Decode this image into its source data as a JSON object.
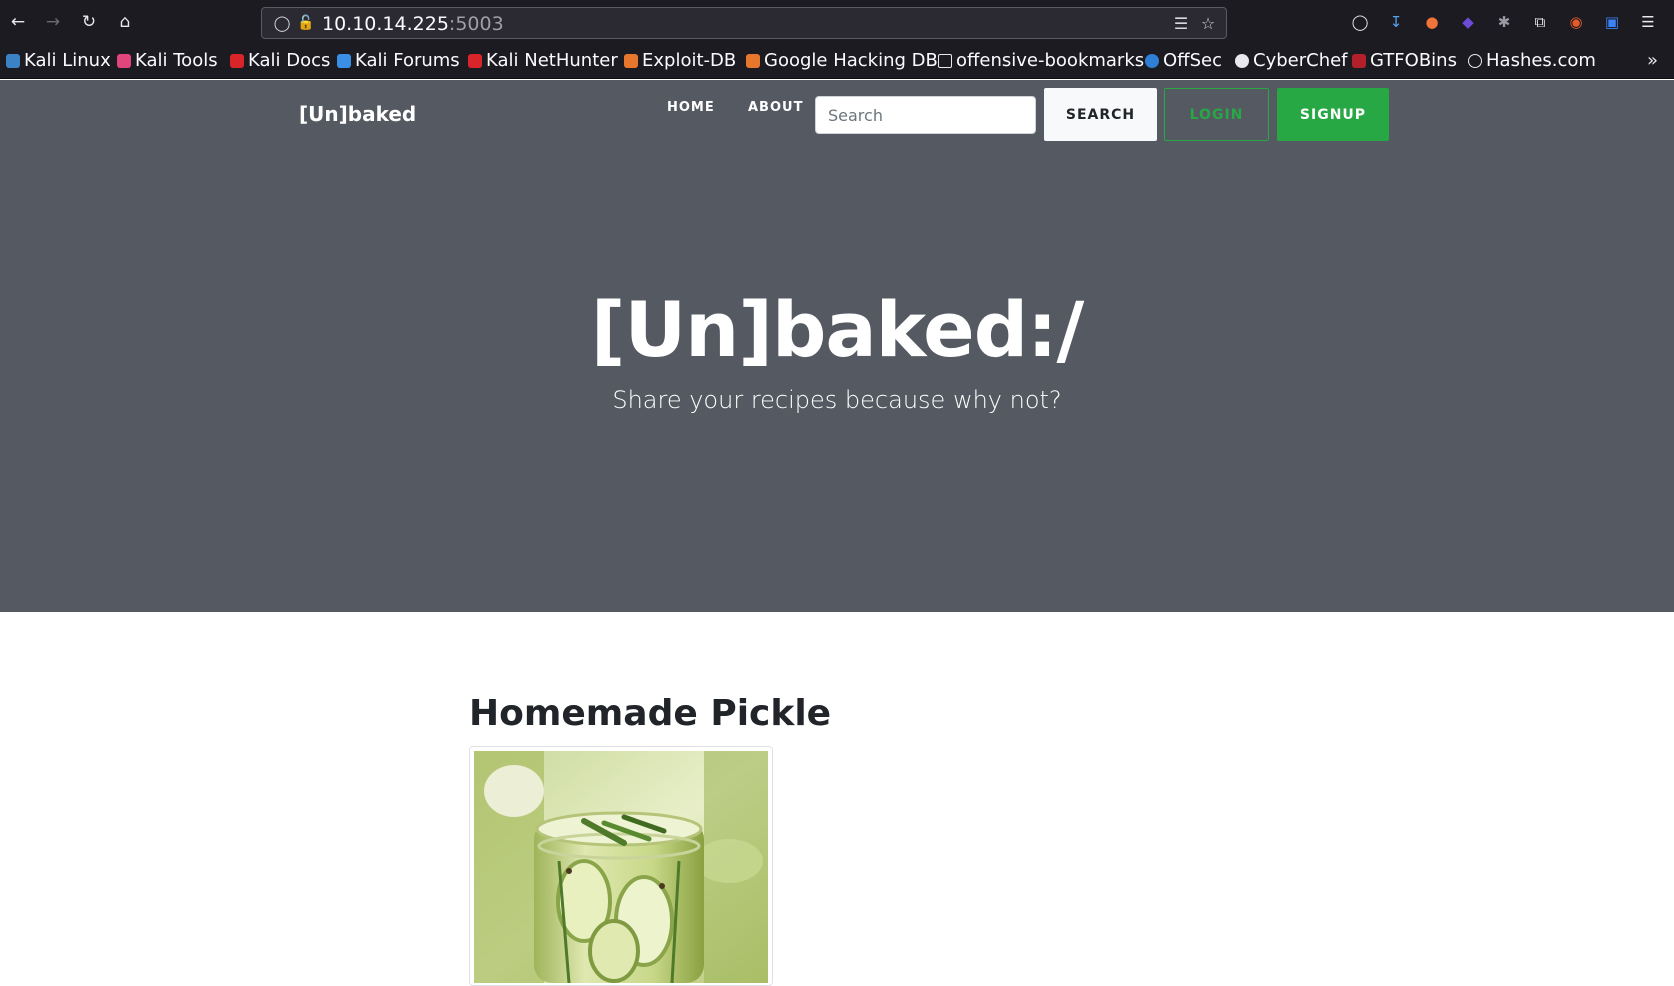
{
  "browser": {
    "url_host": "10.10.14.225",
    "url_port": ":5003",
    "bookmarks": [
      {
        "label": "Kali Linux",
        "color": "#3b82c4"
      },
      {
        "label": "Kali Tools",
        "color": "#e0457b"
      },
      {
        "label": "Kali Docs",
        "color": "#d9252a"
      },
      {
        "label": "Kali Forums",
        "color": "#3a8ee6"
      },
      {
        "label": "Kali NetHunter",
        "color": "#d9252a"
      },
      {
        "label": "Exploit-DB",
        "color": "#e8772e"
      },
      {
        "label": "Google Hacking DB",
        "color": "#e8772e"
      },
      {
        "label": "offensive-bookmarks",
        "color": "folder"
      },
      {
        "label": "OffSec",
        "color": "#2f7fd6"
      },
      {
        "label": "CyberChef",
        "color": "#e8e8ee"
      },
      {
        "label": "GTFOBins",
        "color": "#b3202a"
      },
      {
        "label": "Hashes.com",
        "color": "#e8e8ee"
      }
    ]
  },
  "site": {
    "brand": "[Un]baked",
    "nav": {
      "home": "HOME",
      "about": "ABOUT"
    },
    "search": {
      "placeholder": "Search",
      "button": "SEARCH"
    },
    "login": "LOGIN",
    "signup": "SIGNUP",
    "hero_title": "[Un]baked:/",
    "hero_subtitle": "Share your recipes because why not?"
  },
  "recipe": {
    "title": "Homemade Pickle"
  },
  "colors": {
    "hero_bg": "#555a62",
    "accent_green": "#28a745",
    "browser_bg": "#1c1b22"
  }
}
